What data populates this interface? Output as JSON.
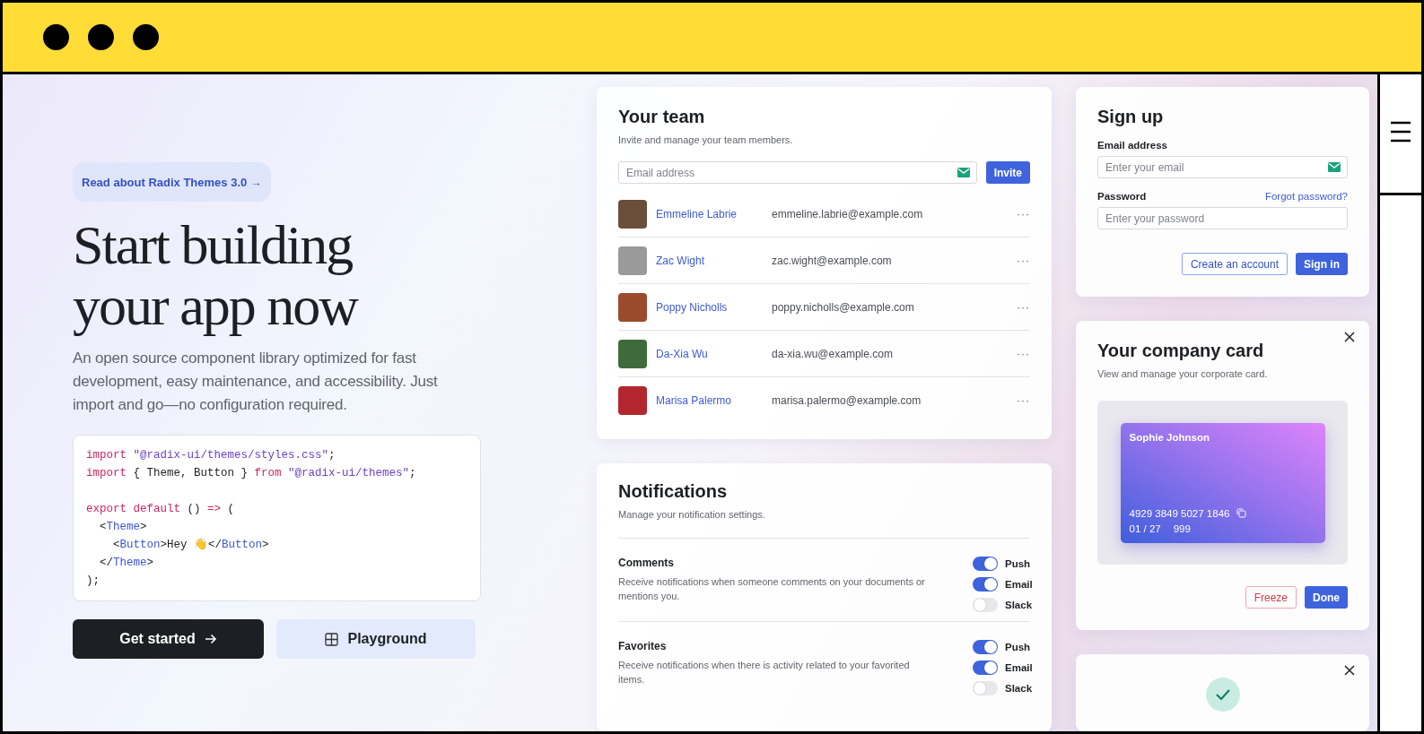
{
  "hero": {
    "badge": "Read about Radix Themes 3.0 →",
    "heading_lines": [
      "Start building",
      "your app now"
    ],
    "description": "An open source component library optimized for fast development, easy maintenance, and accessibility. Just import and go—no configuration required.",
    "code_lines": [
      {
        "tokens": [
          {
            "kind": "keyword",
            "text": "import"
          },
          {
            "kind": "string",
            "text": " \"@radix-ui/themes/styles.css\""
          },
          {
            "kind": "plain",
            "text": ";"
          }
        ]
      },
      {
        "tokens": [
          {
            "kind": "keyword",
            "text": "import"
          },
          {
            "kind": "plain",
            "text": " { Theme, Button } "
          },
          {
            "kind": "keyword",
            "text": "from"
          },
          {
            "kind": "string",
            "text": " \"@radix-ui/themes\""
          },
          {
            "kind": "plain",
            "text": ";"
          }
        ]
      },
      {
        "spaced": true,
        "tokens": [
          {
            "kind": "keyword",
            "text": "export default"
          },
          {
            "kind": "plain",
            "text": " () "
          },
          {
            "kind": "keyword",
            "text": "=>"
          },
          {
            "kind": "plain",
            "text": " ("
          }
        ]
      },
      {
        "tokens": [
          {
            "kind": "plain",
            "text": "  <"
          },
          {
            "kind": "tag",
            "text": "Theme"
          },
          {
            "kind": "plain",
            "text": ">"
          }
        ]
      },
      {
        "tokens": [
          {
            "kind": "plain",
            "text": "    <"
          },
          {
            "kind": "tag",
            "text": "Button"
          },
          {
            "kind": "plain",
            "text": ">Hey 👋</"
          },
          {
            "kind": "tag",
            "text": "Button"
          },
          {
            "kind": "plain",
            "text": ">"
          }
        ]
      },
      {
        "tokens": [
          {
            "kind": "plain",
            "text": "  </"
          },
          {
            "kind": "tag",
            "text": "Theme"
          },
          {
            "kind": "plain",
            "text": ">"
          }
        ]
      },
      {
        "tokens": [
          {
            "kind": "plain",
            "text": ");"
          }
        ]
      }
    ],
    "primary_button": "Get started",
    "secondary_button": "Playground"
  },
  "team": {
    "title": "Your team",
    "subtitle": "Invite and manage your team members.",
    "placeholder": "Email address",
    "invite_button": "Invite",
    "members": [
      {
        "name": "Emmeline Labrie",
        "email": "emmeline.labrie@example.com",
        "more": "···"
      },
      {
        "name": "Zac Wight",
        "email": "zac.wight@example.com",
        "more": "···"
      },
      {
        "name": "Poppy Nicholls",
        "email": "poppy.nicholls@example.com",
        "more": "···"
      },
      {
        "name": "Da-Xia Wu",
        "email": "da-xia.wu@example.com",
        "more": "···"
      },
      {
        "name": "Marisa Palermo",
        "email": "marisa.palermo@example.com",
        "more": "···"
      }
    ]
  },
  "notifications": {
    "title": "Notifications",
    "subtitle": "Manage your notification settings.",
    "items": [
      {
        "title": "Comments",
        "description": "Receive notifications when someone comments on your documents or mentions you.",
        "channels": [
          {
            "label": "Push",
            "on": true
          },
          {
            "label": "Email",
            "on": true
          },
          {
            "label": "Slack",
            "on": false
          }
        ]
      },
      {
        "title": "Favorites",
        "description": "Receive notifications when there is activity related to your favorited items.",
        "channels": [
          {
            "label": "Push",
            "on": true
          },
          {
            "label": "Email",
            "on": true
          },
          {
            "label": "Slack",
            "on": false
          }
        ]
      }
    ]
  },
  "signup": {
    "title": "Sign up",
    "email_label": "Email address",
    "email_placeholder": "Enter your email",
    "password_label": "Password",
    "forgot_link": "Forgot password?",
    "password_placeholder": "Enter your password",
    "create_button": "Create an account",
    "signin_button": "Sign in"
  },
  "company_card": {
    "title": "Your company card",
    "subtitle": "View and manage your corporate card.",
    "holder": "Sophie Johnson",
    "number": "4929 3849 5027 1846",
    "expiry": "01 / 27",
    "cvc": "999",
    "freeze_button": "Freeze",
    "done_button": "Done"
  }
}
